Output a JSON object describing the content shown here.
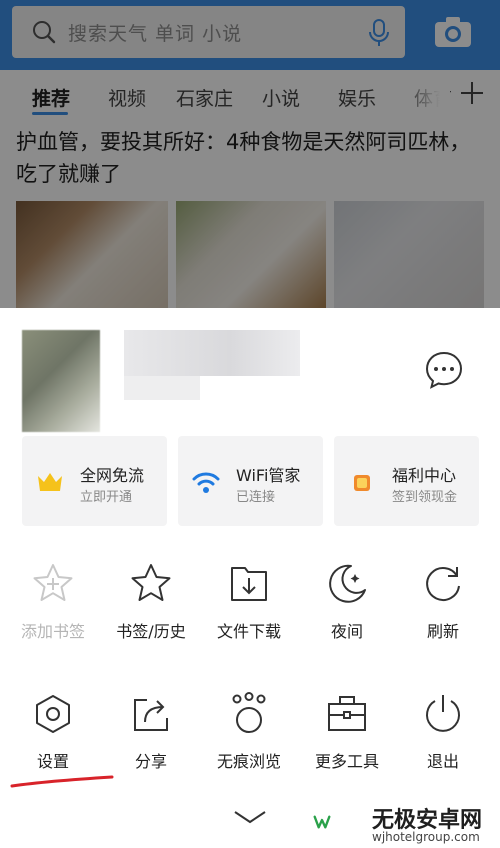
{
  "search": {
    "placeholder": "搜索天气 单词 小说"
  },
  "tabs": [
    "推荐",
    "视频",
    "石家庄",
    "小说",
    "娱乐",
    "体育"
  ],
  "article": {
    "title": "护血管，要投其所好：4种食物是天然阿司匹林，吃了就赚了"
  },
  "cards": [
    {
      "title": "全网免流",
      "subtitle": "立即开通",
      "icon": "crown-icon"
    },
    {
      "title": "WiFi管家",
      "subtitle": "已连接",
      "icon": "wifi-icon"
    },
    {
      "title": "福利中心",
      "subtitle": "签到领现金",
      "icon": "gift-icon"
    }
  ],
  "tools_row1": [
    {
      "label": "添加书签",
      "icon": "add-bookmark-icon",
      "enabled": false
    },
    {
      "label": "书签/历史",
      "icon": "star-icon",
      "enabled": true
    },
    {
      "label": "文件下载",
      "icon": "download-icon",
      "enabled": true
    },
    {
      "label": "夜间",
      "icon": "moon-icon",
      "enabled": true
    },
    {
      "label": "刷新",
      "icon": "refresh-icon",
      "enabled": true
    }
  ],
  "tools_row2": [
    {
      "label": "设置",
      "icon": "settings-hexagon-icon"
    },
    {
      "label": "分享",
      "icon": "share-icon"
    },
    {
      "label": "无痕浏览",
      "icon": "incognito-paw-icon"
    },
    {
      "label": "更多工具",
      "icon": "toolbox-icon"
    },
    {
      "label": "退出",
      "icon": "power-icon"
    }
  ],
  "watermark": {
    "name": "无极安卓网",
    "url": "wjhotelgroup.com"
  },
  "colors": {
    "accent": "#3d8fe6",
    "annotation": "#d8232a",
    "crown": "#f5c21b",
    "gift": "#f08a2c"
  }
}
